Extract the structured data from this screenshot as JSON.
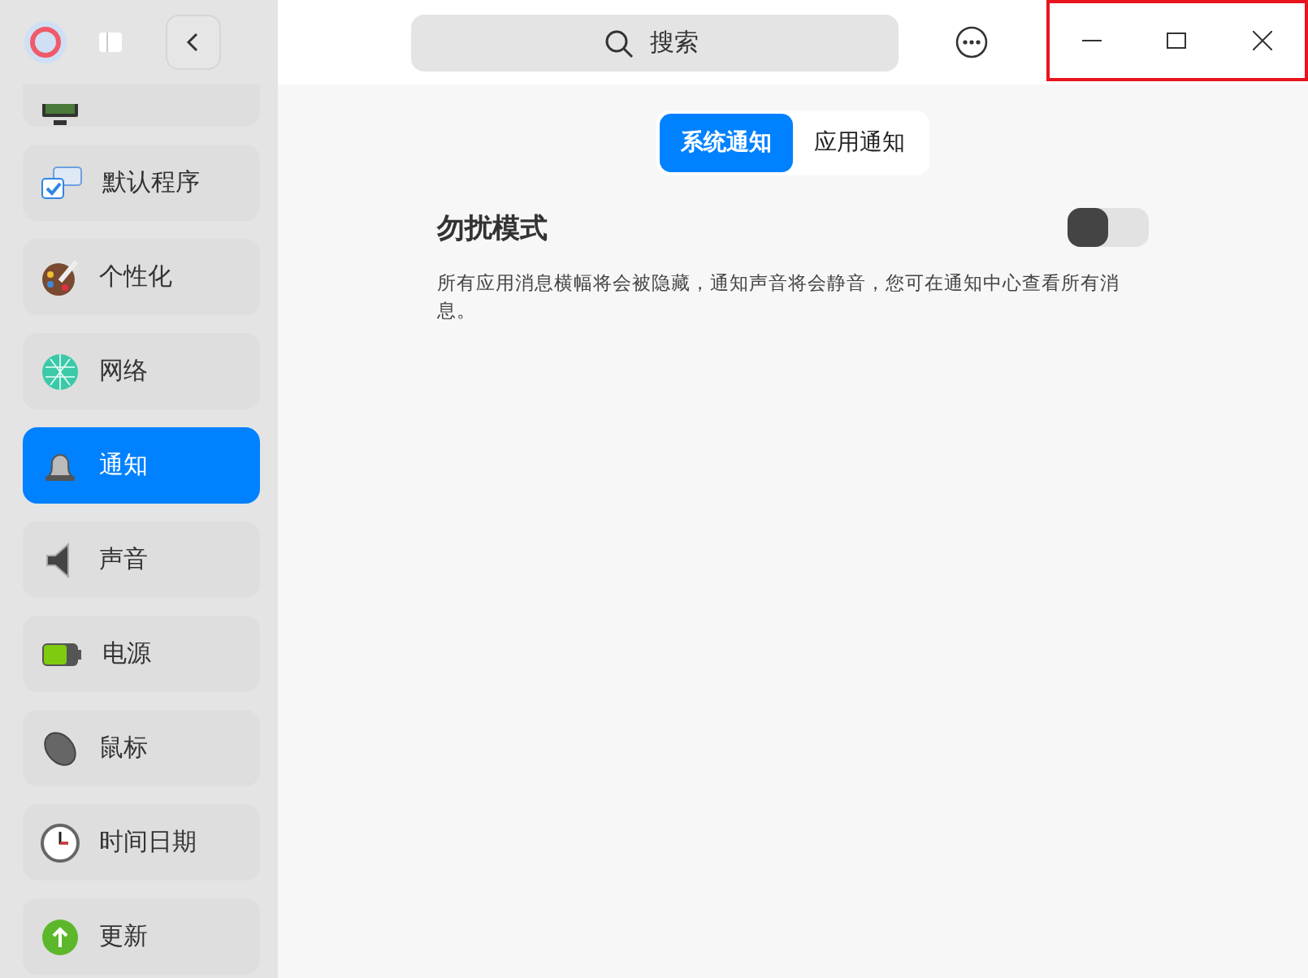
{
  "sidebar": {
    "items": [
      {
        "label": "默认程序",
        "selected": false
      },
      {
        "label": "个性化",
        "selected": false
      },
      {
        "label": "网络",
        "selected": false
      },
      {
        "label": "通知",
        "selected": true
      },
      {
        "label": "声音",
        "selected": false
      },
      {
        "label": "电源",
        "selected": false
      },
      {
        "label": "鼠标",
        "selected": false
      },
      {
        "label": "时间日期",
        "selected": false
      },
      {
        "label": "更新",
        "selected": false
      }
    ]
  },
  "search": {
    "placeholder": "搜索"
  },
  "tabs": [
    {
      "label": "系统通知",
      "selected": true
    },
    {
      "label": "应用通知",
      "selected": false
    }
  ],
  "setting": {
    "title": "勿扰模式",
    "on": false,
    "description": "所有应用消息横幅将会被隐藏，通知声音将会静音，您可在通知中心查看所有消息。"
  }
}
